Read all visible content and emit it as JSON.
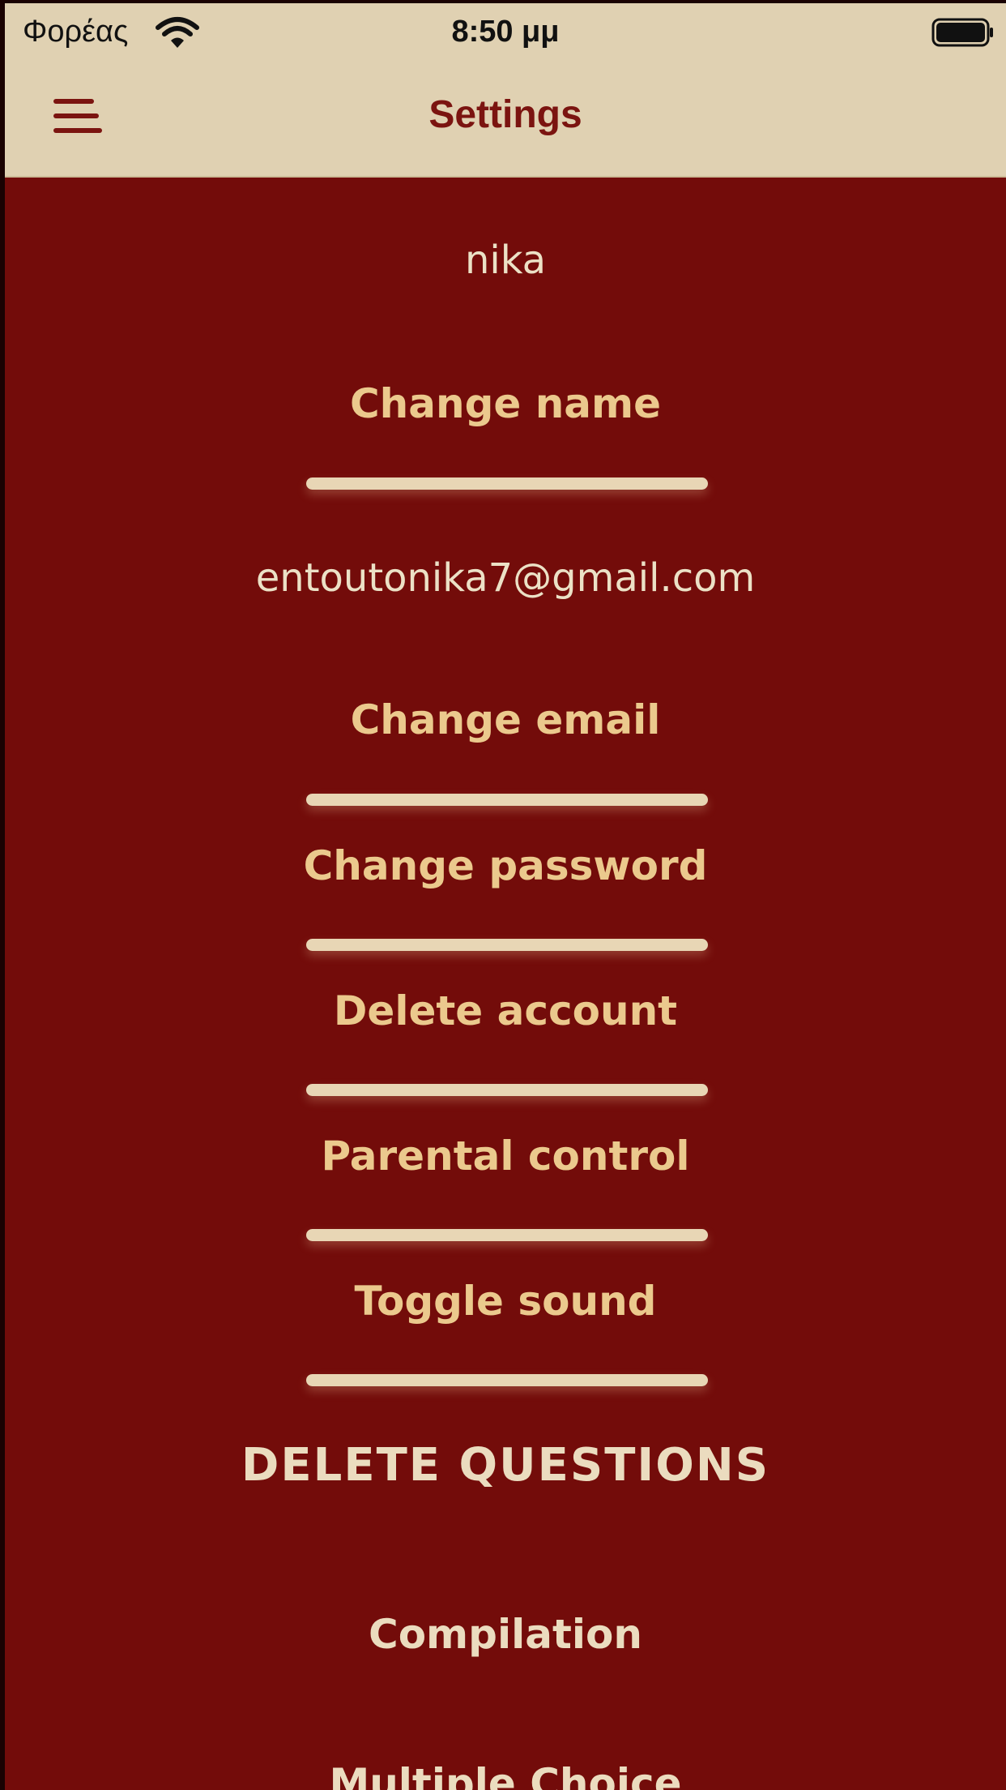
{
  "status_bar": {
    "carrier": "Φορέας",
    "time": "8:50 μμ",
    "wifi_icon": "wifi-icon",
    "battery_icon": "battery-icon"
  },
  "nav": {
    "title": "Settings",
    "menu_icon": "hamburger-menu-icon"
  },
  "settings": {
    "username": "nika",
    "change_name": "Change name",
    "email": "entoutonika7@gmail.com",
    "change_email": "Change email",
    "change_password": "Change password",
    "delete_account": "Delete account",
    "parental_control": "Parental control",
    "toggle_sound": "Toggle sound",
    "delete_questions_heading": "DELETE QUESTIONS",
    "compilation": "Compilation",
    "multiple_choice": "Multiple Choice"
  },
  "colors": {
    "background": "#730c0a",
    "topbar": "#e0d1b2",
    "accent": "#7b1410",
    "action_text": "#ebc98d",
    "value_text": "#ece1c6",
    "divider": "#e8d6b5"
  }
}
